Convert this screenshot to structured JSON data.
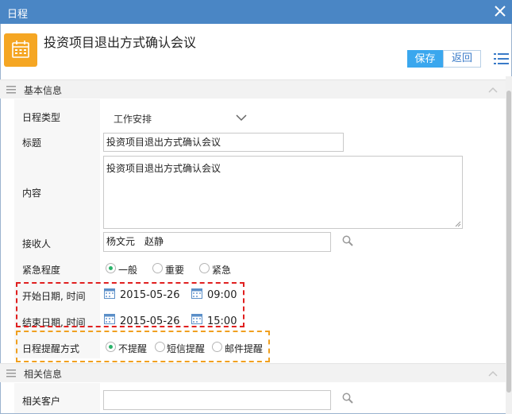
{
  "window": {
    "title": "日程"
  },
  "header": {
    "title": "投资项目退出方式确认会议",
    "save_label": "保存",
    "back_label": "返回"
  },
  "section_basic": {
    "label": "基本信息"
  },
  "section_related": {
    "label": "相关信息"
  },
  "fields": {
    "type": {
      "label": "日程类型",
      "value": "工作安排"
    },
    "title": {
      "label": "标题",
      "value": "投资项目退出方式确认会议"
    },
    "content": {
      "label": "内容",
      "value": "投资项目退出方式确认会议"
    },
    "recipients": {
      "label": "接收人",
      "value": "杨文元　赵静"
    },
    "urgency": {
      "label": "紧急程度",
      "options": [
        "一般",
        "重要",
        "紧急"
      ],
      "selected": "一般"
    },
    "start": {
      "label": "开始日期, 时间",
      "date": "2015-05-26",
      "time": "09:00"
    },
    "end": {
      "label": "结束日期, 时间",
      "date": "2015-05-26",
      "time": "15:00"
    },
    "reminder": {
      "label": "日程提醒方式",
      "options": [
        "不提醒",
        "短信提醒",
        "邮件提醒"
      ],
      "selected": "不提醒"
    },
    "customer": {
      "label": "相关客户",
      "value": ""
    }
  },
  "colors": {
    "titlebar": "#4a86c5",
    "accent": "#3aa7ee",
    "icon_bg": "#f5a623",
    "red_dash": "#e02020",
    "orange_dash": "#f0a020",
    "radio_on": "#2bb36a"
  },
  "icons": [
    "close-icon",
    "calendar-icon",
    "menu-icon",
    "search-icon",
    "chevron-up-icon",
    "chevron-down-icon"
  ]
}
